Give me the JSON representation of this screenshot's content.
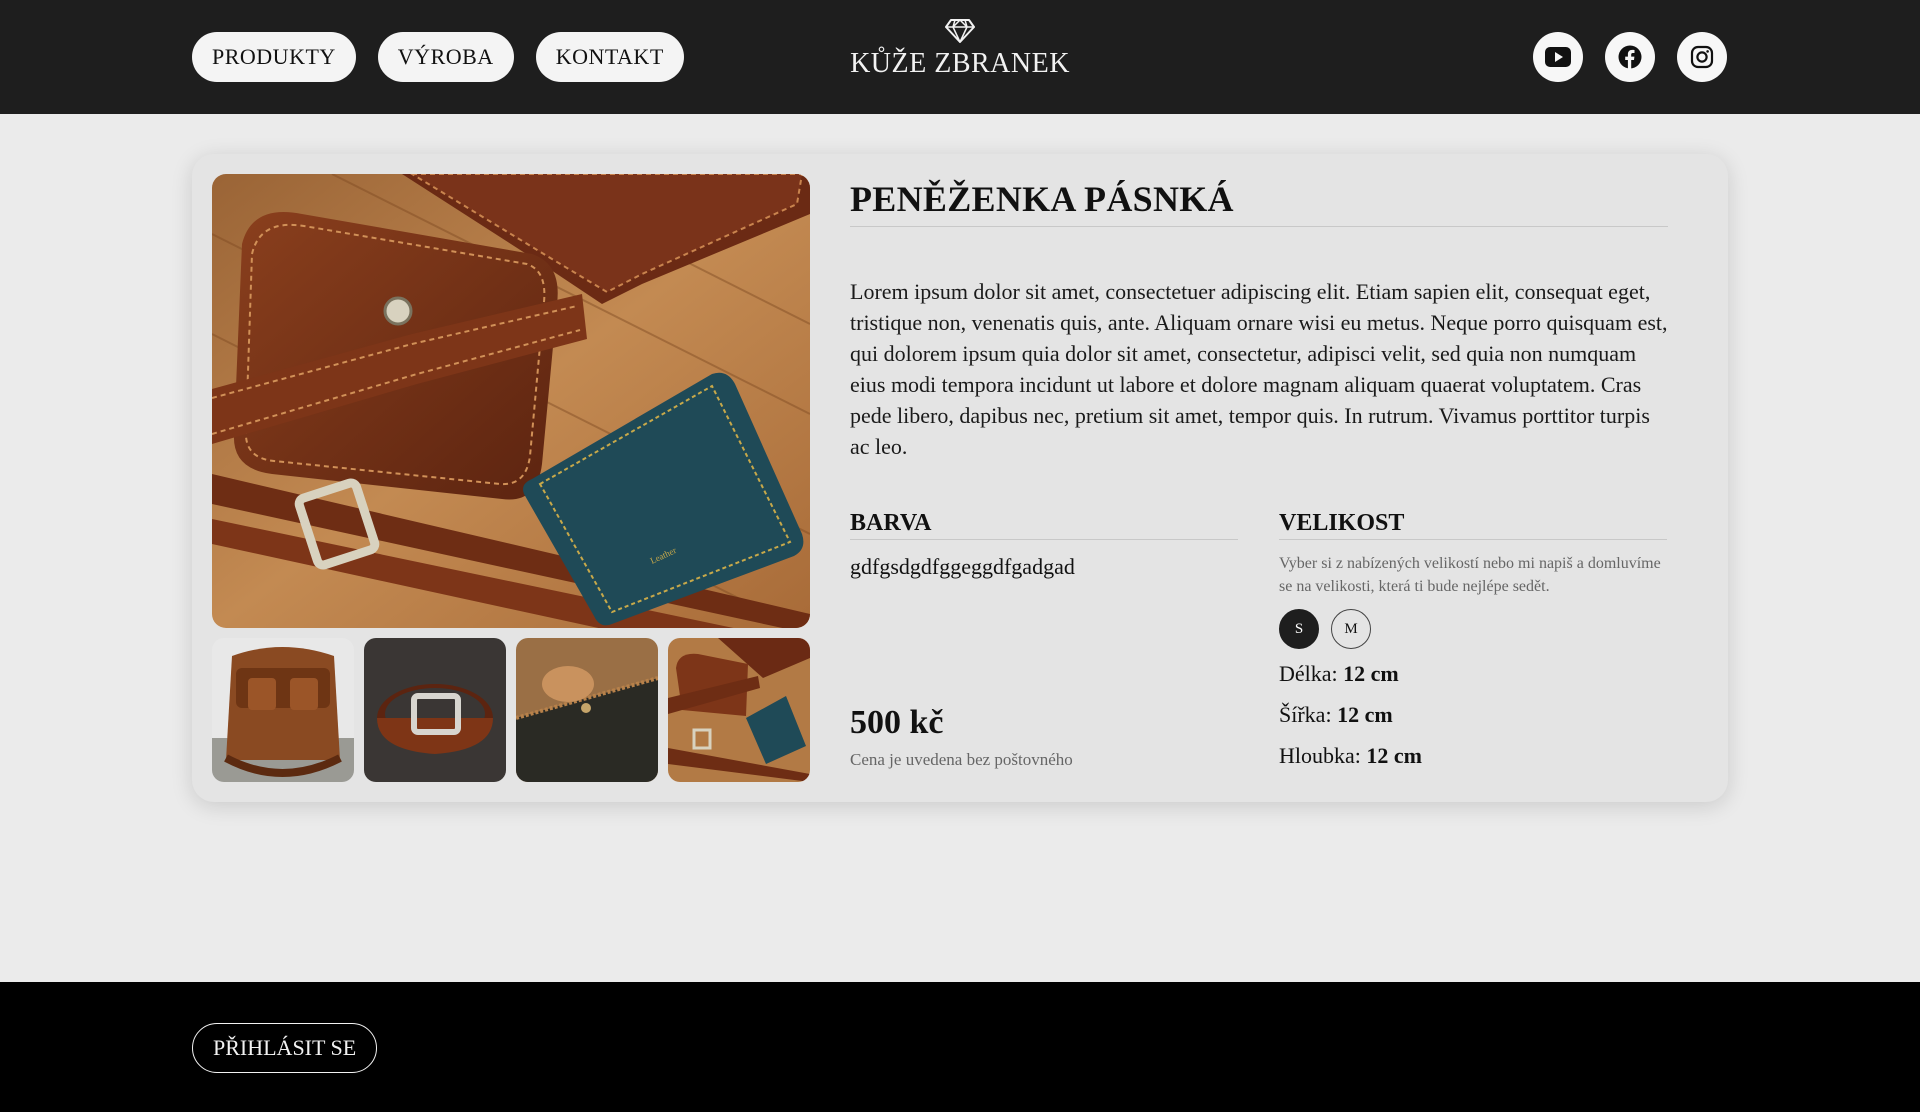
{
  "nav": {
    "items": [
      {
        "label": "PRODUKTY"
      },
      {
        "label": "VÝROBA"
      },
      {
        "label": "KONTAKT"
      }
    ]
  },
  "logo": {
    "text": "KŮŽE ZBRANEK",
    "icon": "diamond-icon"
  },
  "socials": [
    {
      "icon": "youtube-icon"
    },
    {
      "icon": "facebook-icon"
    },
    {
      "icon": "instagram-icon"
    }
  ],
  "product": {
    "title": "PENĚŽENKA PÁSNKÁ",
    "description": "Lorem ipsum dolor sit amet, consectetuer adipiscing elit. Etiam sapien elit, consequat eget, tristique non, venenatis quis, ante. Aliquam ornare wisi eu metus. Neque porro quisquam est, qui dolorem ipsum quia dolor sit amet, consectetur, adipisci velit, sed quia non numquam eius modi tempora incidunt ut labore et dolore magnam aliquam quaerat voluptatem. Cras pede libero, dapibus nec, pretium sit amet, tempor quis. In rutrum. Vivamus porttitor turpis ac leo.",
    "color_heading": "BARVA",
    "color_value": "gdfgsdgdfggeggdfgadgad",
    "size_heading": "VELIKOST",
    "size_hint": "Vyber si z nabízených velikostí nebo mi napiš a domluvíme se na velikosti, která ti bude nejlépe sedět.",
    "sizes": [
      {
        "label": "S",
        "selected": true
      },
      {
        "label": "M",
        "selected": false
      }
    ],
    "dimensions": [
      {
        "label": "Délka:",
        "value": "12 cm"
      },
      {
        "label": "Šířka:",
        "value": "12 cm"
      },
      {
        "label": "Hloubka:",
        "value": "12 cm"
      }
    ],
    "price": "500 kč",
    "price_note": "Cena je uvedena bez poštovného"
  },
  "footer": {
    "login_label": "PŘIHLÁSIT SE"
  },
  "colors": {
    "header_bg": "#1e1e1e",
    "page_bg": "#ebebeb",
    "card_bg": "#e4e4e4",
    "footer_bg": "#000000"
  }
}
